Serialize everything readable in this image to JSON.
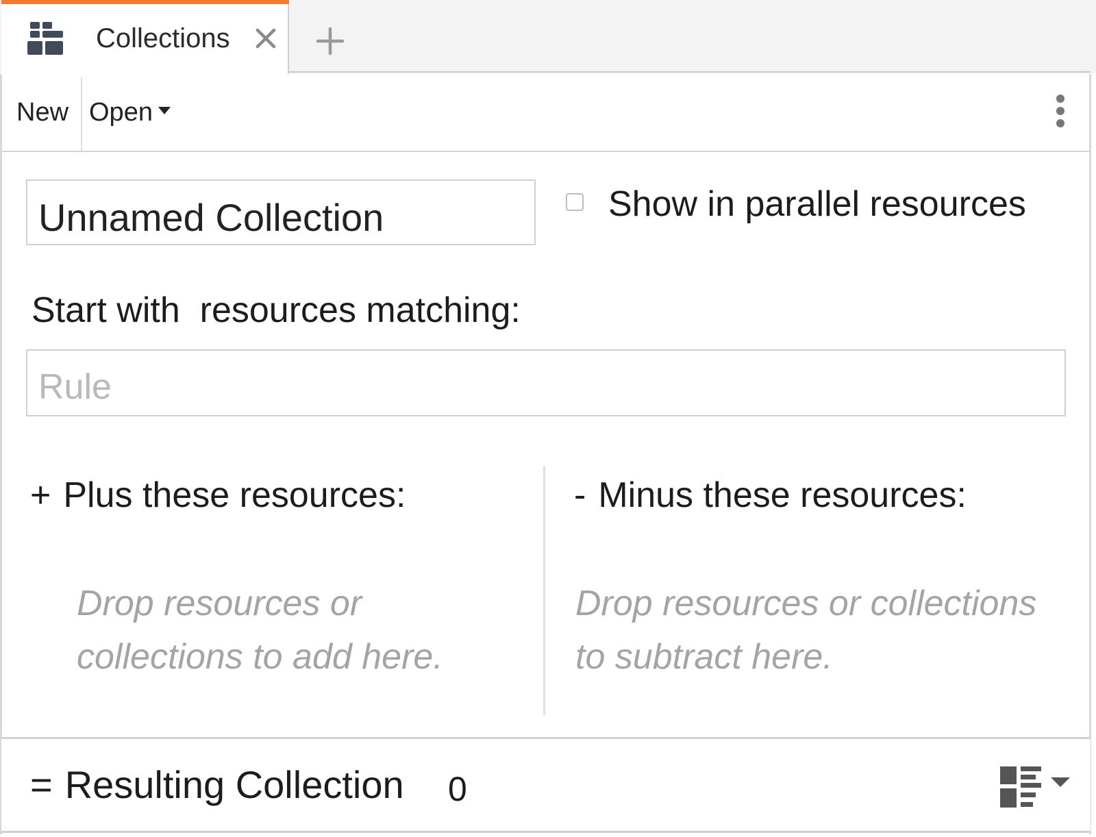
{
  "tab": {
    "label": "Collections",
    "icon": "collections-icon",
    "close_icon": "close-icon",
    "accent_color": "#f37a35"
  },
  "new_tab": {
    "icon": "plus-icon"
  },
  "toolbar": {
    "new_label": "New",
    "open_label": "Open",
    "more_icon": "vertical-ellipsis-icon"
  },
  "collection": {
    "name_value": "Unnamed Collection",
    "show_parallel_label": "Show in parallel resources",
    "show_parallel_checked": false
  },
  "rule": {
    "heading": "Start with  resources matching:",
    "placeholder": "Rule"
  },
  "plus": {
    "operator": "+",
    "heading": "Plus these resources:",
    "drop_hint": "Drop resources or collections to add here."
  },
  "minus": {
    "operator": "-",
    "heading": "Minus these resources:",
    "drop_hint": "Drop resources or collections to subtract here."
  },
  "result": {
    "operator": "=",
    "label": "Resulting Collection",
    "count": "0",
    "view_icon": "grid-list-view-icon"
  }
}
